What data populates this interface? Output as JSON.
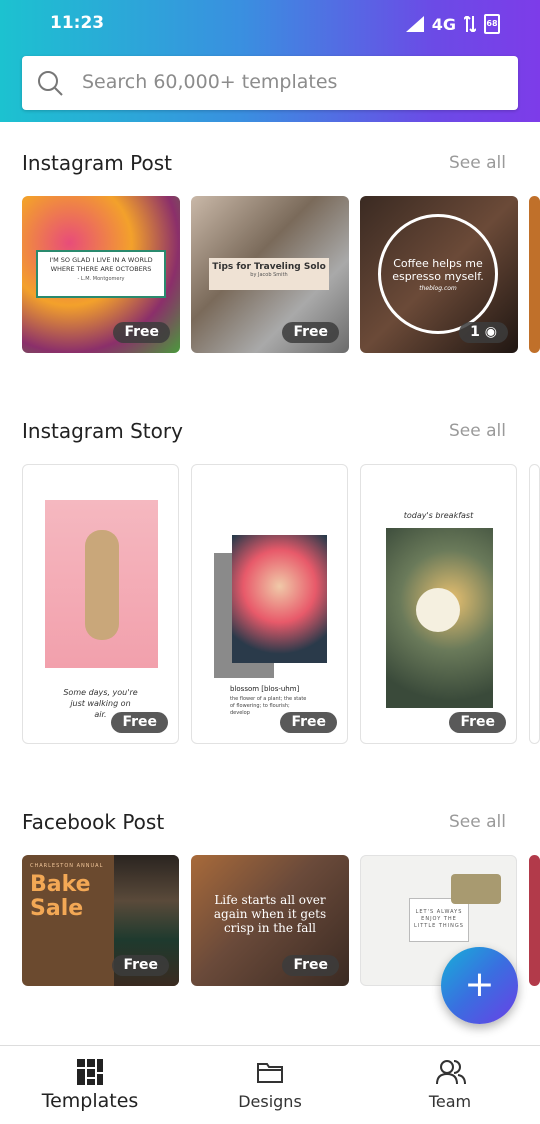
{
  "status_bar": {
    "time": "11:23",
    "network": "4G",
    "battery": "68"
  },
  "search": {
    "placeholder": "Search 60,000+ templates"
  },
  "sections": [
    {
      "title": "Instagram Post",
      "see_all": "See all",
      "cards": [
        {
          "badge": "Free",
          "text": "I'M SO GLAD I LIVE IN A WORLD WHERE THERE ARE OCTOBERS",
          "sub": "- L.M. Montgomery"
        },
        {
          "badge": "Free",
          "text": "Tips for Traveling Solo",
          "sub": "by Jacob Smith"
        },
        {
          "badge": "1",
          "text": "Coffee helps me espresso myself.",
          "sub": "theblog.com"
        }
      ]
    },
    {
      "title": "Instagram Story",
      "see_all": "See all",
      "cards": [
        {
          "badge": "Free",
          "text": "Some days, you're just walking on air."
        },
        {
          "badge": "Free",
          "text": "blossom [blos-uhm]",
          "sub": "the flower of a plant; the state of flowering; to flourish; develop"
        },
        {
          "badge": "Free",
          "text": "today's breakfast"
        }
      ]
    },
    {
      "title": "Facebook Post",
      "see_all": "See all",
      "cards": [
        {
          "badge": "Free",
          "text": "Bake Sale",
          "sub": "CHARLESTON ANNUAL"
        },
        {
          "badge": "Free",
          "text": "Life starts all over again when it gets crisp in the fall"
        },
        {
          "text": "LET'S ALWAYS ENJOY THE LITTLE THINGS"
        }
      ]
    }
  ],
  "fab": {
    "label": "+"
  },
  "bottom_nav": {
    "templates": "Templates",
    "designs": "Designs",
    "team": "Team"
  },
  "colors": {
    "accent_start": "#1cc2d0",
    "accent_end": "#7d3ce9"
  }
}
